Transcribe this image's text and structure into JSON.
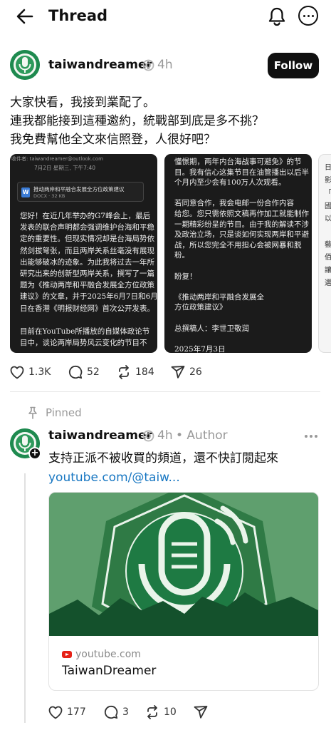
{
  "header": {
    "title": "Thread"
  },
  "post": {
    "username": "taiwandreamer",
    "time": "4h",
    "follow_label": "Follow",
    "text_lines": [
      "大家快看，我接到業配了。",
      "連我都能接到這種邀約，統戰部到底是多不挑？",
      "我免費幫他全文來信照登，人很好吧？"
    ],
    "image1": {
      "meta": "收件者:  taiwandreamer@outlook.com",
      "date": "7月2日 星期三, 下午7:40",
      "attachment_name": "推动两岸和平融合发展全方位政策建议",
      "attachment_meta": "DOCX · 32 KB",
      "lines": [
        "您好！在近几年举办的G7峰会上，最后",
        "发表的联合声明都会强调维护台海和平稳",
        "定的重要性。但现实情况却是台海局势依",
        "然剑拔弩张，而且两岸关系丝毫没有展现",
        "出能够破冰的迹象。为此我将过去一年所",
        "研究出来的创新型两岸关系，撰写了一篇",
        "题为《推动两岸和平融合发展全方位政策",
        "建议》的文章，并于2025年6月7日和6月8",
        "日在香港《明报财经网》首次公开发表。",
        "",
        "目前在YouTube所播放的自媒体政论节",
        "目中，谈论两岸局势风云变化的节目不"
      ]
    },
    "image2": {
      "lines": [
        "懂憬期，两年内台海战事可避免》的节",
        "目。我有信心这集节目在油管播出以后半",
        "个月内至少会有100万人次观看。",
        "",
        "若同意合作，我会电邮一份合作内容",
        "给您。您只需依照文稿再作加工就能制作",
        "一期精彩纷呈的节目。由于我的解读不涉",
        "及政治立场，只是谈如何实现两岸和平避",
        "战，所以您完全不用担心会被网暴和脱",
        "粉。",
        "",
        "盼复！",
        "",
        "《推动两岸和平融合发展全",
        "方位政策建议》",
        "",
        "总撰稿人：李世卫敬润",
        "",
        "2025年7月3日"
      ]
    },
    "image3": {
      "lines": [
        "日",
        "影",
        "「",
        "國",
        "以",
        "",
        "藝",
        "佰",
        "讓",
        "選"
      ]
    },
    "actions": {
      "likes": "1.3K",
      "comments": "52",
      "reposts": "184",
      "shares": "26"
    }
  },
  "pinned_label": "Pinned",
  "reply": {
    "username": "taiwandreamer",
    "time": "4h",
    "author_tag": "• Author",
    "text": "支持正派不被收買的頻道，還不快訂閱起來",
    "link_text": "youtube.com/@taiw...",
    "card": {
      "site": "youtube.com",
      "title": "TaiwanDreamer"
    },
    "actions": {
      "likes": "177",
      "comments": "3",
      "reposts": "10"
    }
  },
  "colors": {
    "follow_bg": "#101010",
    "link": "#1877c2",
    "brand_green": "#1e8a4f",
    "muted": "#999999"
  }
}
